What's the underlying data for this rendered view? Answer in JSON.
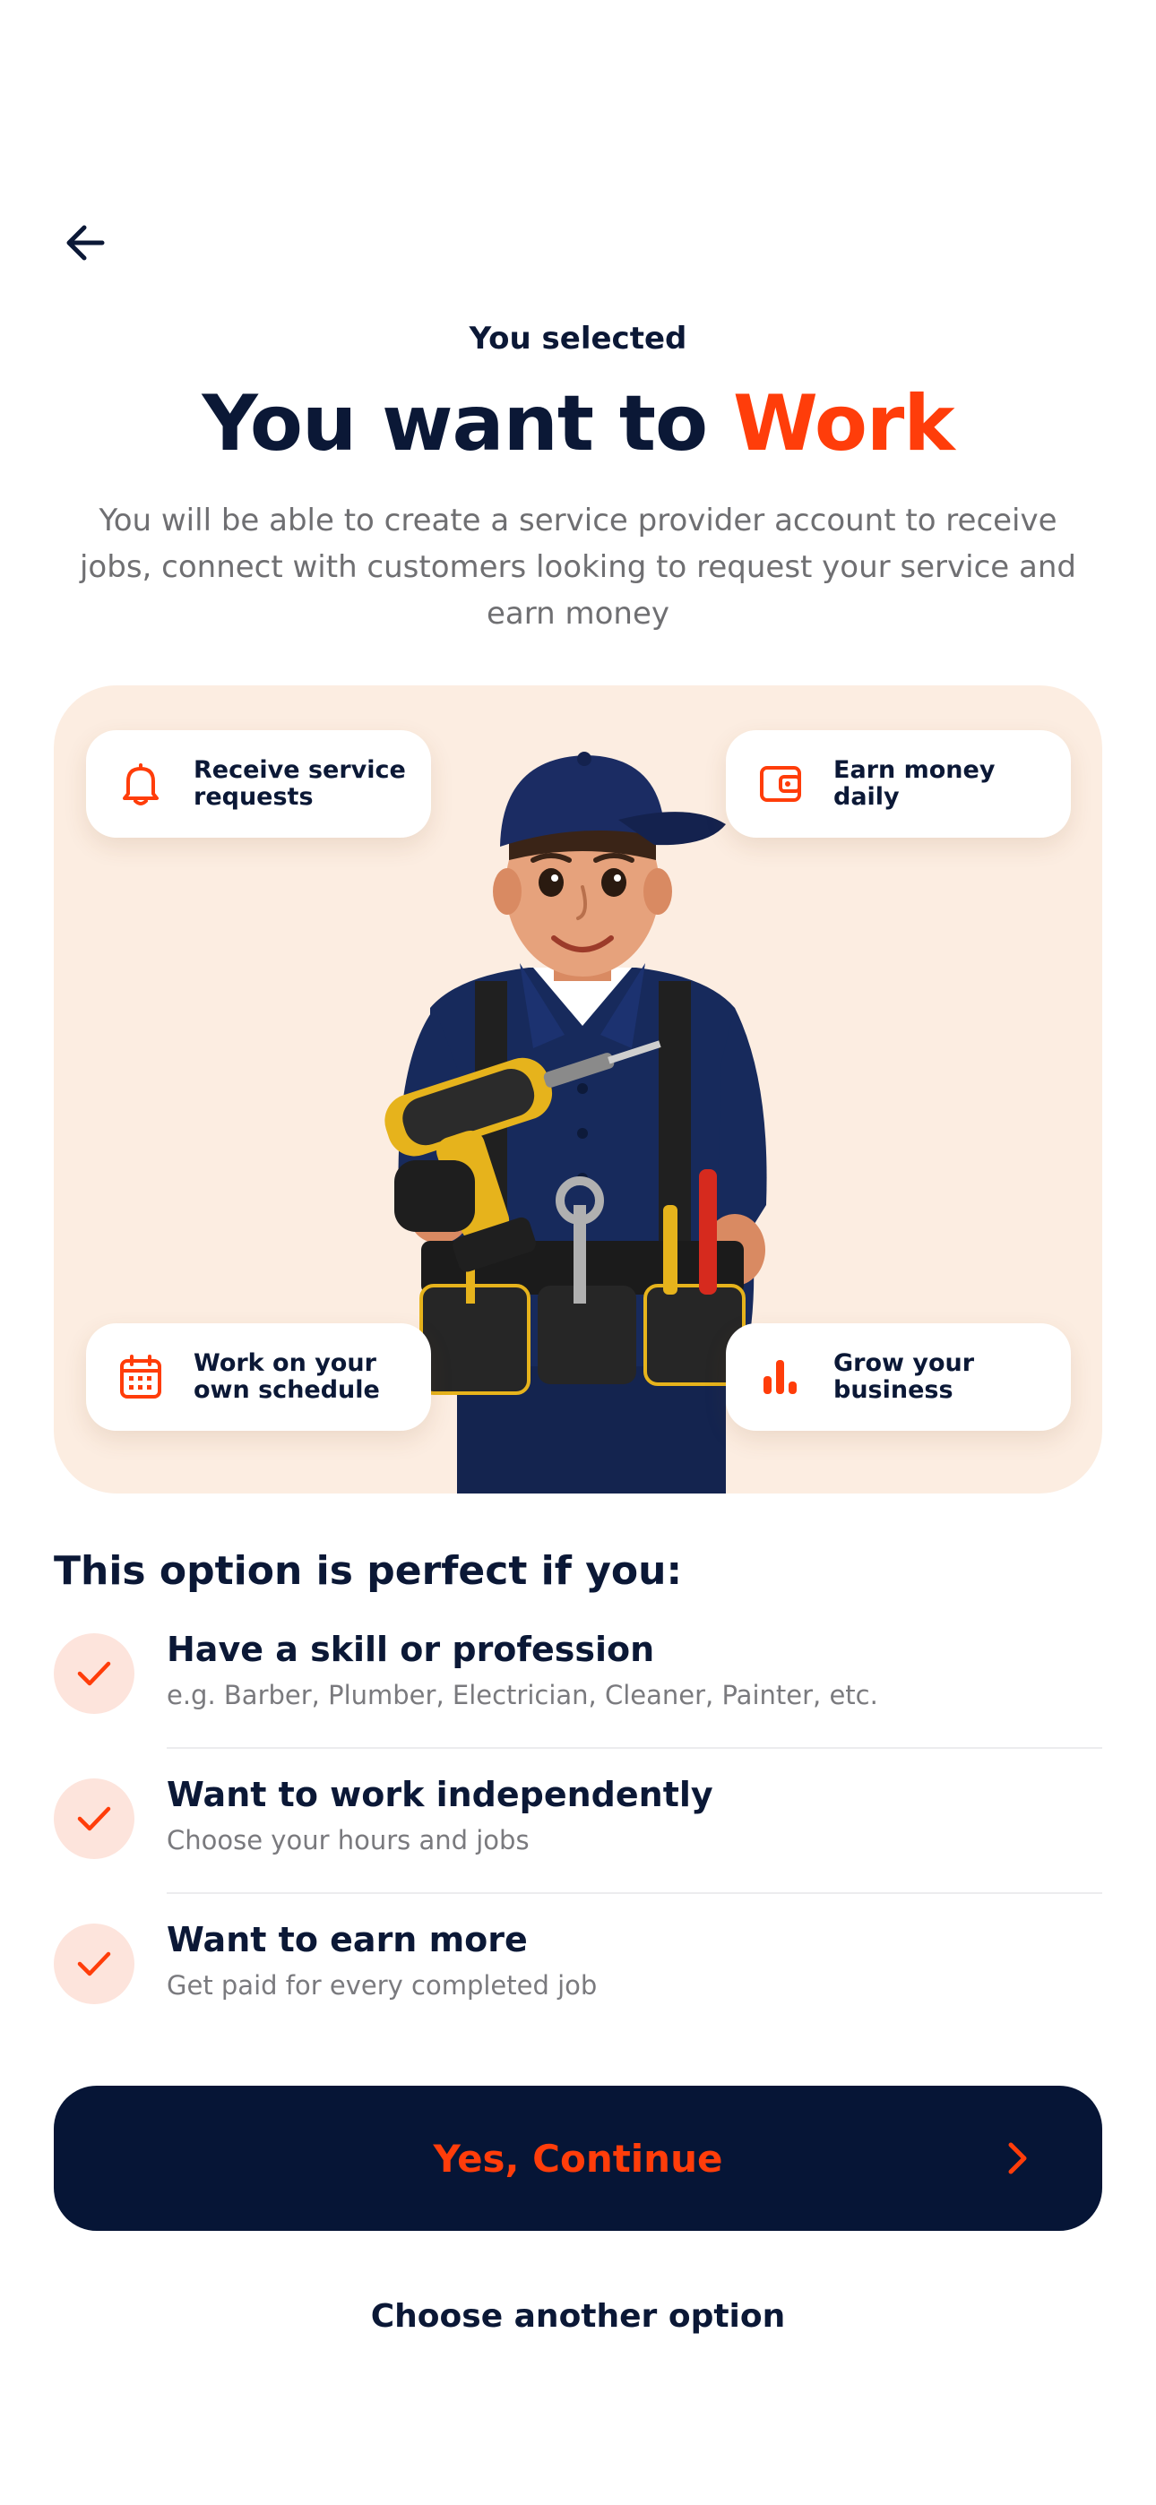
{
  "header": {
    "eyebrow": "You selected",
    "headline_prefix": "You want to",
    "headline_accent": "Work",
    "intro": "You will be able to create a service provider account to receive jobs, connect with customers looking to request your service and earn money"
  },
  "hero": {
    "features": [
      {
        "label": "Receive service requests",
        "icon": "bell-icon"
      },
      {
        "label": "Earn money daily",
        "icon": "wallet-icon"
      },
      {
        "label": "Work on your own schedule",
        "icon": "calendar-icon"
      },
      {
        "label": "Grow your business",
        "icon": "bar-chart-icon"
      }
    ]
  },
  "criteria": {
    "title": "This option is perfect if you:",
    "items": [
      {
        "title": "Have a skill or profession",
        "subtitle": "e.g. Barber, Plumber, Electrician, Cleaner, Painter, etc."
      },
      {
        "title": "Want to work independently",
        "subtitle": "Choose your hours and jobs"
      },
      {
        "title": "Want to earn more",
        "subtitle": "Get paid for every completed job"
      }
    ]
  },
  "actions": {
    "continue_label": "Yes, Continue",
    "alt_label": "Choose another option"
  },
  "colors": {
    "accent": "#ff3d0a",
    "navy": "#061536",
    "hero_bg": "#fcede1",
    "check_bg": "#fde4dc"
  }
}
